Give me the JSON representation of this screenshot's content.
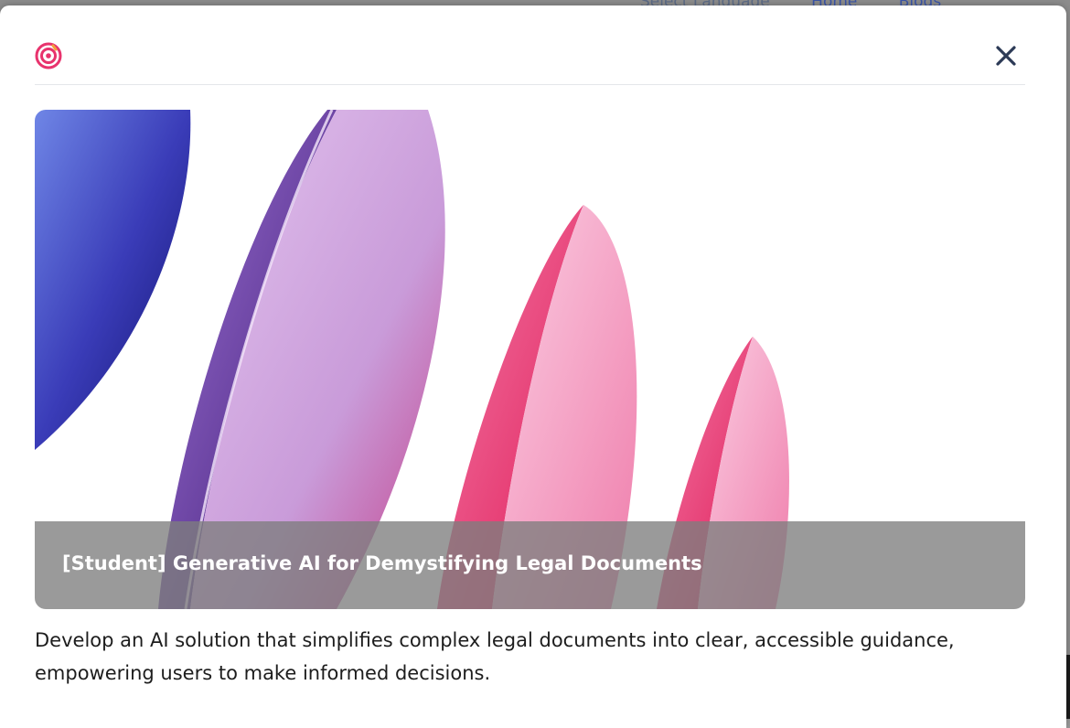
{
  "background_nav": {
    "language": "Select Language",
    "home": "Home",
    "blogs": "Blogs"
  },
  "modal": {
    "logo_icon": "target-icon",
    "close_icon": "close-icon",
    "hero_title": "[Student] Generative AI for Demystifying Legal Documents",
    "description": "Develop an AI solution that simplifies complex legal documents into clear, accessible guidance, empowering users to make informed decisions."
  },
  "colors": {
    "close_icon": "#2c3a56",
    "logo_pink": "#e8336d",
    "logo_orange": "#f2a23a",
    "caption_overlay": "#7d7d7d"
  }
}
